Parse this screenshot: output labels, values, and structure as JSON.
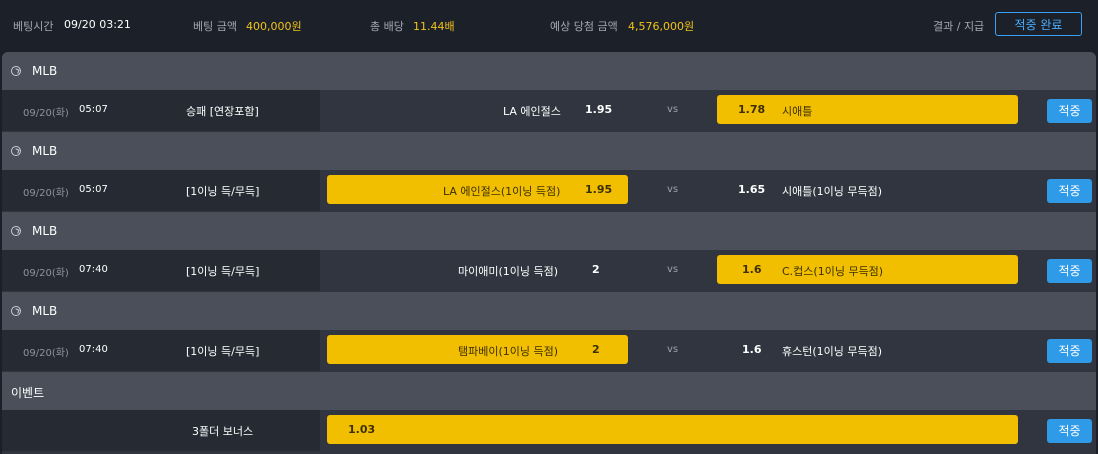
{
  "summary": {
    "bet_time_label": "베팅시간",
    "bet_time_value": "09/20 03:21",
    "bet_amount_label": "베팅 금액",
    "bet_amount_value": "400,000원",
    "total_odds_label": "총 배당",
    "total_odds_value": "11.44배",
    "expected_win_label": "예상 당첨 금액",
    "expected_win_value": "4,576,000원",
    "result_label": "결과 / 지급",
    "result_button": "적중 완료"
  },
  "colors": {
    "accent_gold": "#f1bf00",
    "apply_blue": "#2f9be8",
    "outline_blue": "#3aa0f5"
  },
  "groups": [
    {
      "league": "MLB",
      "icon": "baseball-icon",
      "date": "09/20(화)",
      "time": "05:07",
      "bet_type": "승패 [연장포함]",
      "home_team": "LA 에인절스",
      "home_odds": "1.95",
      "vs": "vs",
      "away_odds": "1.78",
      "away_team": "시애틀",
      "selected": "away",
      "status": "적중"
    },
    {
      "league": "MLB",
      "icon": "baseball-icon",
      "date": "09/20(화)",
      "time": "05:07",
      "bet_type": "[1이닝 득/무득]",
      "home_team": "LA 에인절스(1이닝 득점)",
      "home_odds": "1.95",
      "vs": "vs",
      "away_odds": "1.65",
      "away_team": "시애틀(1이닝 무득점)",
      "selected": "home",
      "status": "적중"
    },
    {
      "league": "MLB",
      "icon": "baseball-icon",
      "date": "09/20(화)",
      "time": "07:40",
      "bet_type": "[1이닝 득/무득]",
      "home_team": "마이애미(1이닝 득점)",
      "home_odds": "2",
      "vs": "vs",
      "away_odds": "1.6",
      "away_team": "C.컵스(1이닝 무득점)",
      "selected": "away",
      "status": "적중"
    },
    {
      "league": "MLB",
      "icon": "baseball-icon",
      "date": "09/20(화)",
      "time": "07:40",
      "bet_type": "[1이닝 득/무득]",
      "home_team": "탬파베이(1이닝 득점)",
      "home_odds": "2",
      "vs": "vs",
      "away_odds": "1.6",
      "away_team": "휴스턴(1이닝 무득점)",
      "selected": "home",
      "status": "적중"
    }
  ],
  "event": {
    "title": "이벤트",
    "bet_type": "3폴더 보너스",
    "odds": "1.03",
    "status": "적중"
  }
}
